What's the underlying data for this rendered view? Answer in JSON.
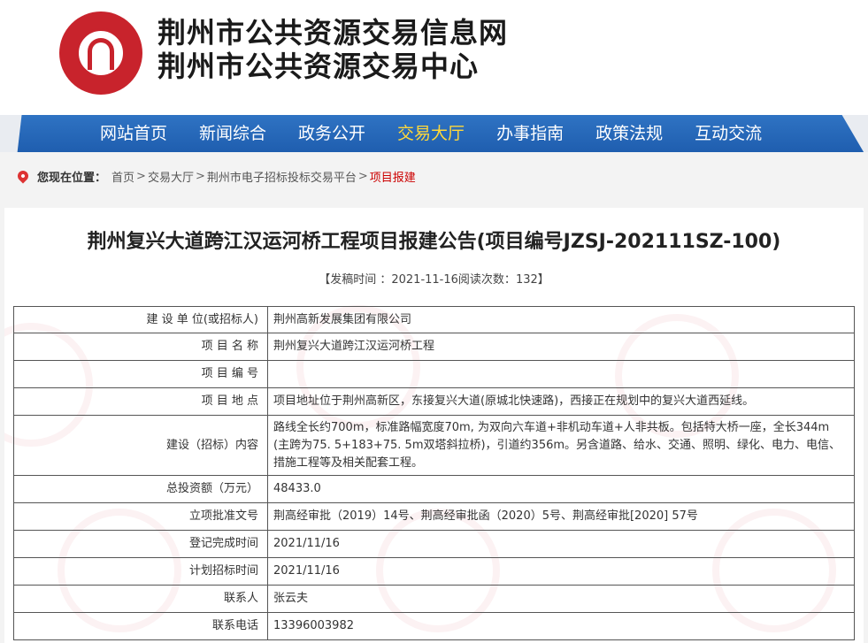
{
  "header": {
    "title_line1": "荆州市公共资源交易信息网",
    "title_line2": "荆州市公共资源交易中心",
    "logo_icon": "jingzhou-resource-logo-icon"
  },
  "nav": {
    "items": [
      {
        "label": "网站首页"
      },
      {
        "label": "新闻综合"
      },
      {
        "label": "政务公开"
      },
      {
        "label": "交易大厅"
      },
      {
        "label": "办事指南"
      },
      {
        "label": "政策法规"
      },
      {
        "label": "互动交流"
      }
    ],
    "active": "交易大厅",
    "active_color": "#ffd83a",
    "bar_color": "#2f73c3"
  },
  "breadcrumb": {
    "label": "您现在位置：",
    "items": [
      "首页",
      "交易大厅",
      "荆州市电子招标投标交易平台"
    ],
    "separator": ">",
    "current": "项目报建"
  },
  "article": {
    "title": "荆州复兴大道跨江汉运河桥工程项目报建公告(项目编号JZSJ-202111SZ-100)",
    "meta_open": "【发稿时间 ：",
    "publish_date": "2021-11-16",
    "read_label": "阅读次数：",
    "read_count": "132",
    "meta_close": "】"
  },
  "table": {
    "rows": [
      {
        "key": "建 设 单 位(或招标人)",
        "value": "荆州高新发展集团有限公司"
      },
      {
        "key": "项 目 名 称",
        "value": "荆州复兴大道跨江汉运河桥工程"
      },
      {
        "key": "项 目 编 号",
        "value": ""
      },
      {
        "key": "项 目 地 点",
        "value": "项目地址位于荆州高新区，东接复兴大道(原城北快速路)，西接正在规划中的复兴大道西延线。"
      },
      {
        "key": "建设（招标）内容",
        "value": "路线全长约700m，标准路幅宽度70m, 为双向六车道+非机动车道+人非共板。包括特大桥一座，全长344m (主跨为75. 5+183+75. 5m双塔斜拉桥)，引道约356m。另含道路、给水、交通、照明、绿化、电力、电信、措施工程等及相关配套工程。"
      },
      {
        "key": "总投资额（万元）",
        "value": "48433.0"
      },
      {
        "key": "立项批准文号",
        "value": "荆高经审批（2019）14号、荆高经审批函（2020）5号、荆高经审批[2020] 57号"
      },
      {
        "key": "登记完成时间",
        "value": "2021/11/16"
      },
      {
        "key": "计划招标时间",
        "value": "2021/11/16"
      },
      {
        "key": "联系人",
        "value": "张云夫"
      },
      {
        "key": "联系电话",
        "value": "13396003982"
      }
    ]
  }
}
